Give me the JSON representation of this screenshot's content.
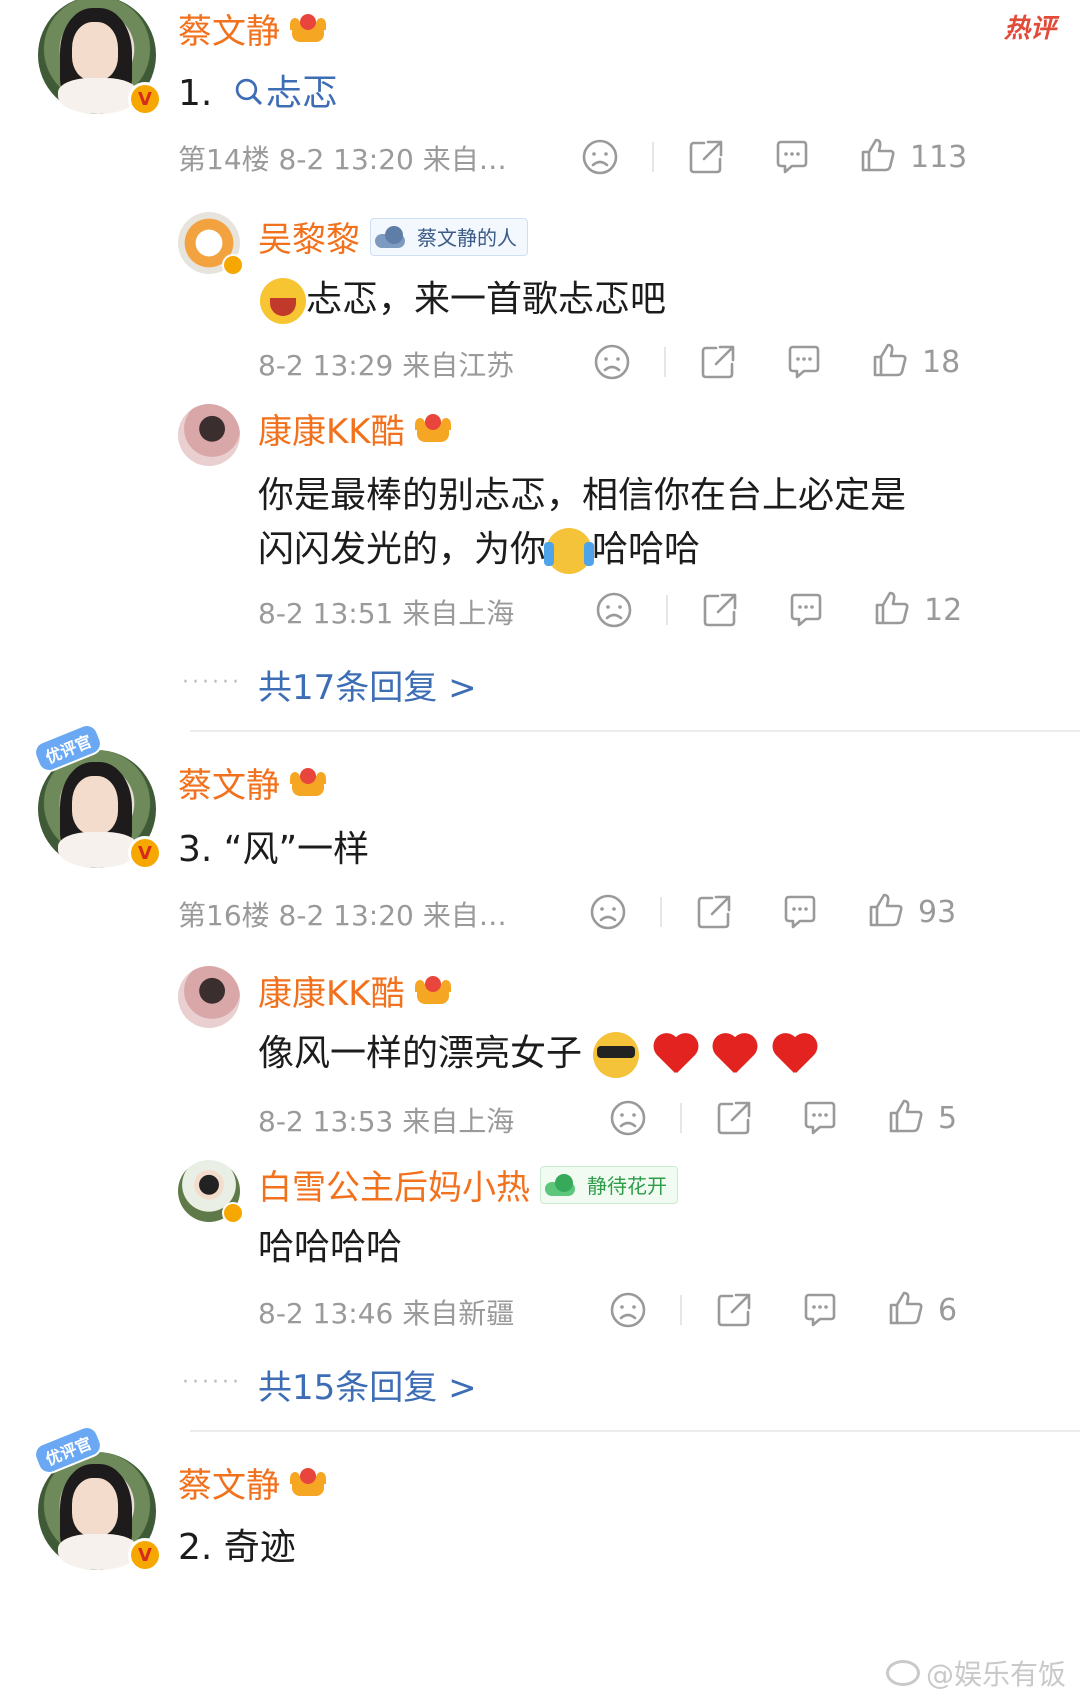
{
  "hot_label": "热评",
  "watermark": "@娱乐有饭",
  "badge_label": "优评官",
  "threads": [
    {
      "author": "蔡文静",
      "number": "1.",
      "search_text": "忐忑",
      "meta": "第14楼  8-2 13:20  来自…",
      "likes": "113",
      "replies": [
        {
          "name": "吴黎黎",
          "fan_tag": "蔡文静的人",
          "text": "忐忑，来一首歌忐忑吧",
          "meta": "8-2 13:29  来自江苏",
          "likes": "18"
        },
        {
          "name": "康康KK酷",
          "text_line1": "你是最棒的别忐忑，相信你在台上必定是",
          "text_line2a": "闪闪发光的，为你",
          "text_line2b": "哈哈哈",
          "meta": "8-2 13:51  来自上海",
          "likes": "12"
        }
      ],
      "more": "共17条回复 >"
    },
    {
      "author": "蔡文静",
      "text": "3. “风”一样",
      "meta": "第16楼  8-2 13:20  来自…",
      "likes": "93",
      "replies": [
        {
          "name": "康康KK酷",
          "text": "像风一样的漂亮女子",
          "meta": "8-2 13:53  来自上海",
          "likes": "5"
        },
        {
          "name": "白雪公主后妈小热",
          "fan_tag": "静待花开",
          "text": "哈哈哈哈",
          "meta": "8-2 13:46  来自新疆",
          "likes": "6"
        }
      ],
      "more": "共15条回复 >"
    },
    {
      "author": "蔡文静",
      "text": "2. 奇迹"
    }
  ],
  "icons": [
    "sad-face-icon",
    "share-icon",
    "comment-icon",
    "thumbs-up-icon"
  ]
}
